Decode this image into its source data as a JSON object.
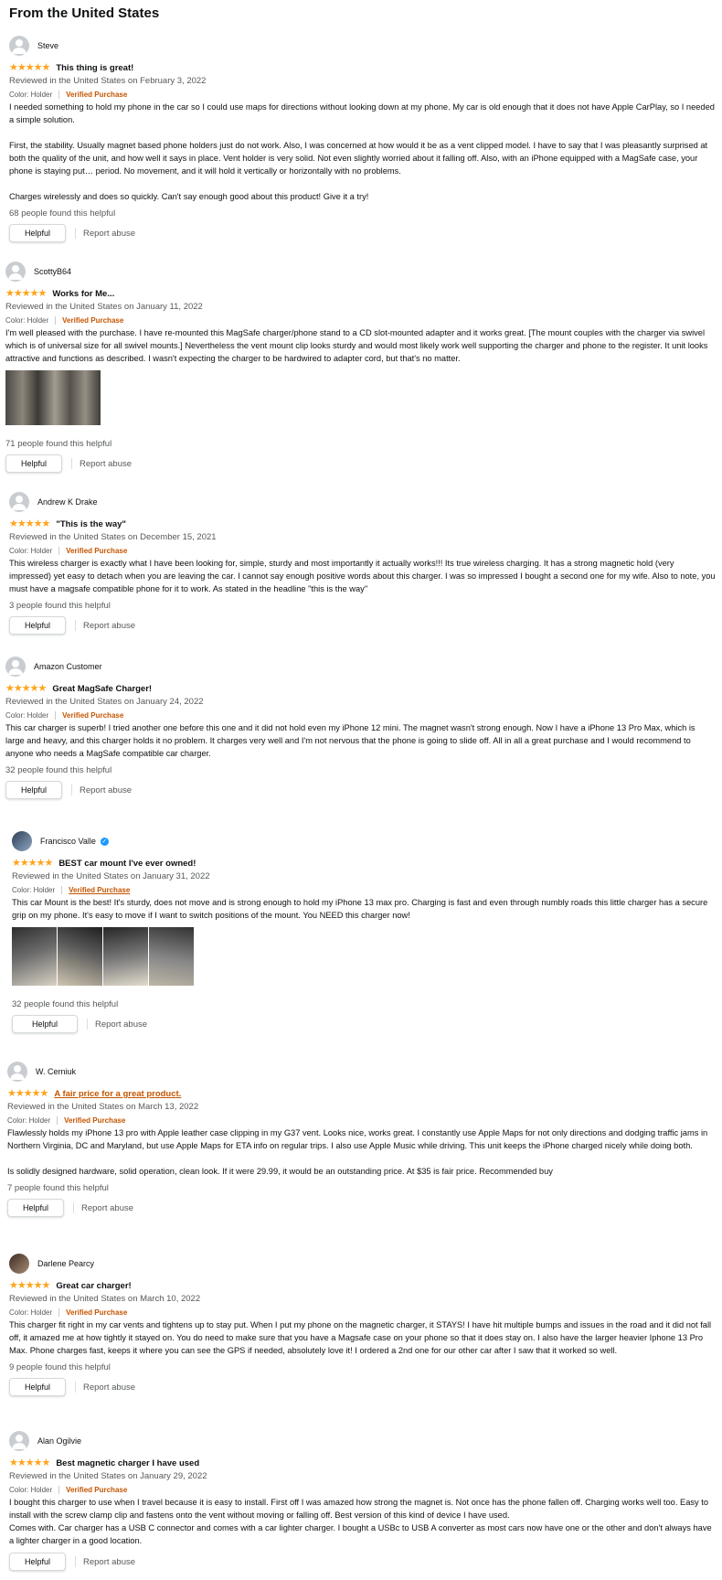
{
  "heading": "From the United States",
  "common": {
    "helpful_label": "Helpful",
    "report_label": "Report abuse",
    "stars": "★★★★★"
  },
  "reviews": [
    {
      "name": "Steve",
      "title": "This thing is great!",
      "date": "Reviewed in the United States on February 3, 2022",
      "color": "Color: Holder",
      "vp": "Verified Purchase",
      "body": [
        "I needed something to hold my phone in the car so I could use maps for directions without looking down at my phone. My car is old enough that it does not have Apple CarPlay, so I needed a simple solution.",
        "First, the stability. Usually magnet based phone holders just do not work. Also, I was concerned at how would it be as a vent clipped model. I have to say that I was pleasantly surprised at both the quality of the unit, and how well it says in place. Vent holder is very solid. Not even slightly worried about it falling off. Also, with an iPhone equipped with a MagSafe case, your phone is staying put… period. No movement, and it will hold it vertically or horizontally with no problems.",
        "Charges wirelessly and does so quickly. Can't say enough good about this product! Give it a try!"
      ],
      "helpful": "68 people found this helpful"
    },
    {
      "name": "ScottyB64",
      "title": "Works for Me...",
      "date": "Reviewed in the United States on January 11, 2022",
      "color": "Color: Holder",
      "vp": "Verified Purchase",
      "body": [
        "I'm well pleased with the purchase. I have re-mounted this MagSafe charger/phone stand to a CD slot-mounted adapter and it works great. [The mount couples with the charger via swivel which is of universal size for all swivel mounts.] Nevertheless the vent mount clip looks sturdy and would most likely work well supporting the charger and phone to the register. It unit looks attractive and functions as described. I wasn't expecting the charger to be hardwired to adapter cord, but that's no matter."
      ],
      "helpful": "71 people found this helpful"
    },
    {
      "name": "Andrew K Drake",
      "title": "\"This is the way\"",
      "date": "Reviewed in the United States on December 15, 2021",
      "color": "Color: Holder",
      "vp": "Verified Purchase",
      "body": [
        "This wireless charger is exactly what I have been looking for, simple, sturdy and most importantly it actually works!!! Its true wireless charging. It has a strong magnetic hold (very impressed) yet easy to detach when you are leaving the car. I cannot say enough positive words about this charger. I was so impressed I bought a second one for my wife. Also to note, you must have a magsafe compatible phone for it to work. As stated in the headline \"this is the way\""
      ],
      "helpful": "3 people found this helpful"
    },
    {
      "name": "Amazon Customer",
      "title": "Great MagSafe Charger!",
      "date": "Reviewed in the United States on January 24, 2022",
      "color": "Color: Holder",
      "vp": "Verified Purchase",
      "body": [
        "This car charger is superb! I tried another one before this one and it did not hold even my iPhone 12 mini. The magnet wasn't strong enough. Now I have a iPhone 13 Pro Max, which is large and heavy, and this charger holds it no problem. It charges very well and I'm not nervous that the phone is going to slide off. All in all a great purchase and I would recommend to anyone who needs a MagSafe compatible car charger."
      ],
      "helpful": "32 people found this helpful"
    },
    {
      "name": "Francisco Valle",
      "title": "BEST car mount I've ever owned!",
      "date": "Reviewed in the United States on January 31, 2022",
      "color": "Color: Holder",
      "vp": "Verified Purchase",
      "body": [
        "This car Mount is the best! It's sturdy, does not move and is strong enough to hold my iPhone 13 max pro. Charging is fast and even through numbly roads this little charger has a secure grip on my phone. It's easy to move if I want to switch positions of the mount. You NEED this charger now!"
      ],
      "helpful": "32 people found this helpful"
    },
    {
      "name": "W. Cerniuk",
      "title": "A fair price for a great product.",
      "date": "Reviewed in the United States on March 13, 2022",
      "color": "Color: Holder",
      "vp": "Verified Purchase",
      "body": [
        "Flawlessly holds my iPhone 13 pro with Apple leather case clipping in my G37 vent. Looks nice, works great. I constantly use Apple Maps for not only directions and dodging traffic jams in Northern Virginia, DC and Maryland, but use Apple Maps for ETA info on regular trips. I also use Apple Music while driving. This unit keeps the iPhone charged nicely while doing both.",
        "Is solidly designed hardware, solid operation, clean look. If it were 29.99, it would be an outstanding price. At $35 is fair price. Recommended buy"
      ],
      "helpful": "7 people found this helpful"
    },
    {
      "name": "Darlene Pearcy",
      "title": "Great car charger!",
      "date": "Reviewed in the United States on March 10, 2022",
      "color": "Color: Holder",
      "vp": "Verified Purchase",
      "body": [
        "This charger fit right in my car vents and tightens up to stay put. When I put my phone on the magnetic charger, it STAYS! I have hit multiple bumps and issues in the road and it did not fall off, it amazed me at how tightly it stayed on. You do need to make sure that you have a Magsafe case on your phone so that it does stay on. I also have the larger heavier Iphone 13 Pro Max. Phone charges fast, keeps it where you can see the GPS if needed, absolutely love it! I ordered a 2nd one for our other car after I saw that it worked so well."
      ],
      "helpful": "9 people found this helpful"
    },
    {
      "name": "Alan Ogilvie",
      "title": "Best magnetic charger I have used",
      "date": "Reviewed in the United States on January 29, 2022",
      "color": "Color: Holder",
      "vp": "Verified Purchase",
      "body": [
        "I bought this charger to use when I travel because it is easy to install. First off I was amazed how strong the magnet is. Not once has the phone fallen off. Charging works well too. Easy to install with the screw clamp clip and fastens onto the vent without moving or falling off. Best version of this kind of device I have used.\nComes with. Car charger has a USB C connector and comes with a car lighter charger. I bought a USBc to USB A converter as most cars now have one or the other and don't always have a lighter charger in a good location."
      ],
      "helpful": ""
    }
  ]
}
